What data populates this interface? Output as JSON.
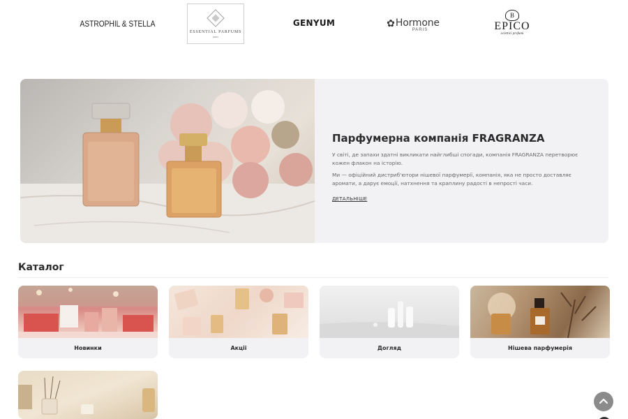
{
  "brands": {
    "astrophil": "ASTROPHIL & STELLA",
    "essential": "ESSENTIAL PARFUMS",
    "essential_sub": "PARIS",
    "genyum": "GENYUM",
    "hormone": "Hormone",
    "hormone_sub": "PARIS",
    "epico": "EPICO",
    "epico_sub": "eclettici profumi"
  },
  "hero": {
    "title": "Парфумерна компанія FRAGRANZA",
    "paragraph_1": "У світі, де запахи здатні викликати найглибші спогади, компанія FRAGRANZA перетворює кожен флакон на історію.",
    "paragraph_2": "Ми — офіційний дистриб'ютори нішевої парфумерії, компанія, яка не просто доставляє аромати, а дарує емоції, натхнення та краплину радості в непрості часи.",
    "link_label": "ДЕТАЛЬНІШЕ"
  },
  "catalog": {
    "title": "Каталог",
    "items": [
      {
        "label": "Новинки"
      },
      {
        "label": "Акції"
      },
      {
        "label": "Догляд"
      },
      {
        "label": "Нішева парфумерія"
      },
      {
        "label": ""
      }
    ]
  },
  "icons": {
    "scroll_top": "chevron-up-icon"
  },
  "colors": {
    "card_bg": "#f2f2f4",
    "scroll_button": "#8b8b8b"
  }
}
